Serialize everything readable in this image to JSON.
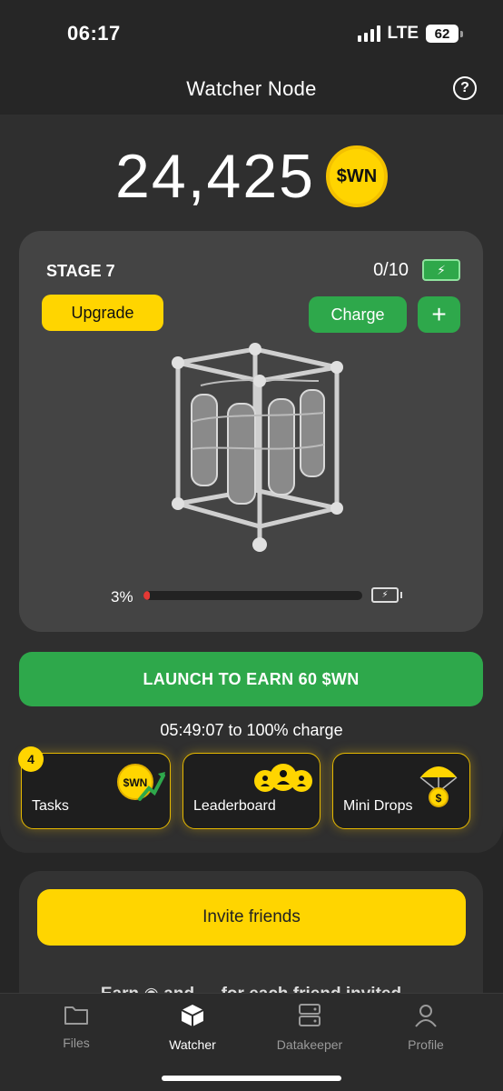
{
  "status_bar": {
    "time": "06:17",
    "network": "LTE",
    "battery": "62"
  },
  "header": {
    "title": "Watcher Node",
    "help_glyph": "?"
  },
  "balance": {
    "value": "24,425",
    "coin_label": "$WN"
  },
  "stage": {
    "label": "STAGE 7",
    "charge_count": "0/10",
    "upgrade_label": "Upgrade",
    "charge_label": "Charge",
    "plus_glyph": "+",
    "progress_text": "3%",
    "progress_value": 0.03
  },
  "launch": {
    "label": "LAUNCH TO EARN 60 $WN",
    "countdown": "05:49:07 to 100% charge"
  },
  "tiles": {
    "tasks": {
      "label": "Tasks",
      "badge": "4",
      "icon_text": "$WN"
    },
    "leaderboard": {
      "label": "Leaderboard"
    },
    "mini_drops": {
      "label": "Mini Drops",
      "icon_text": "$"
    }
  },
  "invite": {
    "button_label": "Invite friends",
    "note": "Earn ◉ and ▬ for each friend invited"
  },
  "nav": [
    {
      "label": "Files",
      "icon": "folder-icon"
    },
    {
      "label": "Watcher",
      "icon": "cube-icon"
    },
    {
      "label": "Datakeeper",
      "icon": "server-icon"
    },
    {
      "label": "Profile",
      "icon": "person-icon"
    }
  ],
  "colors": {
    "background": "#262626",
    "card": "#444444",
    "accent_yellow": "#ffd500",
    "accent_green": "#2ea84b",
    "progress_red": "#e53935"
  }
}
